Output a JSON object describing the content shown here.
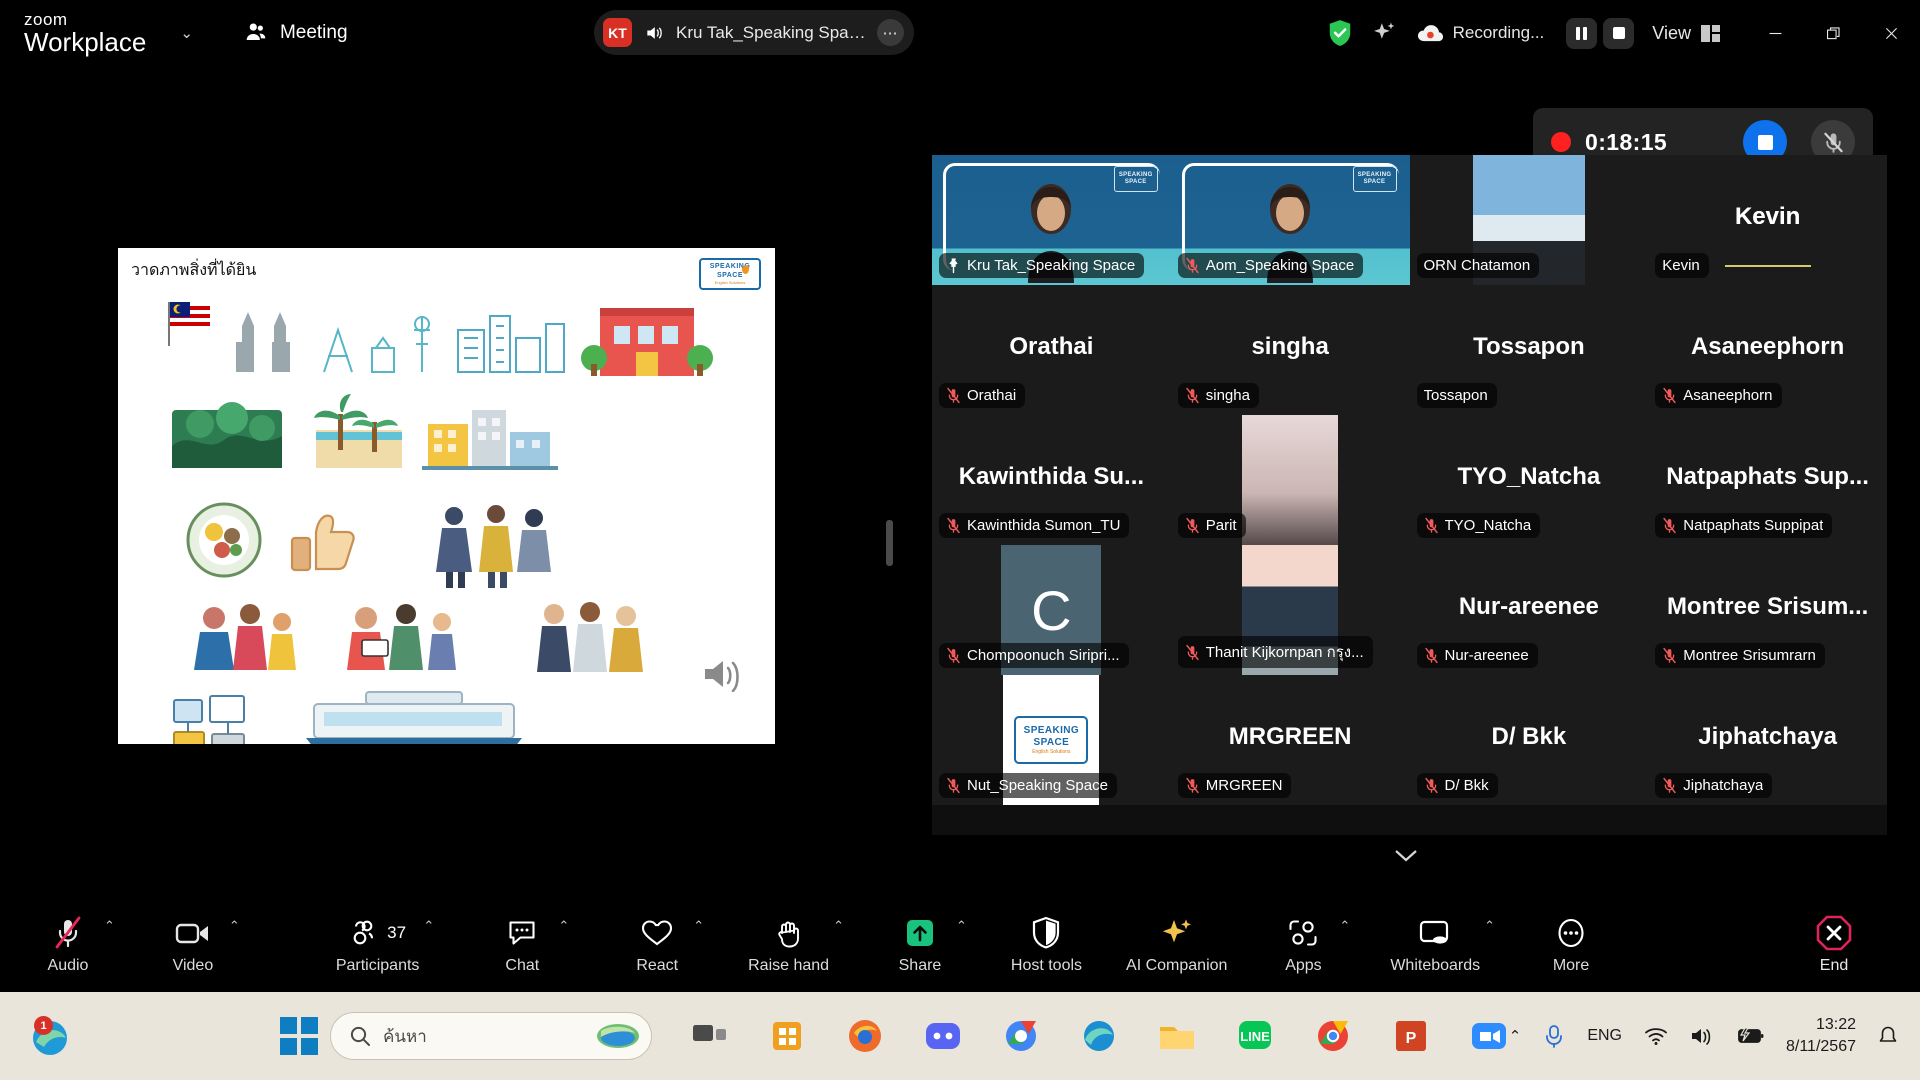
{
  "titlebar": {
    "product_line1": "zoom",
    "product_line2": "Workplace",
    "chevron": "⌄",
    "meeting_label": "Meeting",
    "meeting_pill": {
      "avatar_initials": "KT",
      "title": "Kru Tak_Speaking Space's sc",
      "more": "⋯"
    },
    "recording_label": "Recording...",
    "view_label": "View"
  },
  "recording_widget": {
    "elapsed": "0:18:15"
  },
  "share": {
    "slide_title": "วาดภาพสิ่งที่ได้ยิน",
    "logo_top": "SPEAKING",
    "logo_mid": "SPACE",
    "logo_sub": "English   Solutions",
    "side_ellipsis": "⋮"
  },
  "grid": {
    "rows": [
      [
        {
          "name": "Kru Tak_Speaking Space",
          "display": "",
          "kind": "video-blue",
          "muted": false,
          "pinned": true,
          "speaking": true
        },
        {
          "name": "Aom_Speaking Space",
          "display": "",
          "kind": "video-blue",
          "muted": true,
          "pinned": false,
          "speaking": false
        },
        {
          "name": "ORN Chatamon",
          "display": "",
          "kind": "photo-sky",
          "muted": false,
          "pinned": false,
          "speaking": false
        },
        {
          "name": "Kevin",
          "display": "Kevin",
          "kind": "name",
          "muted": false,
          "pinned": false,
          "speaking": false
        }
      ],
      [
        {
          "name": "Orathai",
          "display": "Orathai",
          "kind": "name",
          "muted": true,
          "pinned": false,
          "speaking": false
        },
        {
          "name": "singha",
          "display": "singha",
          "kind": "name",
          "muted": true,
          "pinned": false,
          "speaking": false
        },
        {
          "name": "Tossapon",
          "display": "Tossapon",
          "kind": "name",
          "muted": false,
          "pinned": false,
          "speaking": false
        },
        {
          "name": "Asaneephorn",
          "display": "Asaneephorn",
          "kind": "name",
          "muted": true,
          "pinned": false,
          "speaking": false
        }
      ],
      [
        {
          "name": "Kawinthida Sumon_TU",
          "display": "Kawinthida Su...",
          "kind": "name",
          "muted": true,
          "pinned": false,
          "speaking": false
        },
        {
          "name": "Parit",
          "display": "",
          "kind": "photo-parit",
          "muted": true,
          "pinned": false,
          "speaking": false
        },
        {
          "name": "TYO_Natcha",
          "display": "TYO_Natcha",
          "kind": "name",
          "muted": true,
          "pinned": false,
          "speaking": false
        },
        {
          "name": "Natpaphats Suppipat",
          "display": "Natpaphats Sup...",
          "kind": "name",
          "muted": true,
          "pinned": false,
          "speaking": false
        }
      ],
      [
        {
          "name": "Chompoonuch Siripri...",
          "display": "C",
          "kind": "avatar-letter",
          "muted": true,
          "pinned": false,
          "speaking": false
        },
        {
          "name": "Thanit Kijkornpan กรุง...",
          "display": "",
          "kind": "photo-thanit",
          "muted": true,
          "pinned": false,
          "speaking": false
        },
        {
          "name": "Nur-areenee",
          "display": "Nur-areenee",
          "kind": "name",
          "muted": true,
          "pinned": false,
          "speaking": false
        },
        {
          "name": "Montree Srisumrarn",
          "display": "Montree Srisum...",
          "kind": "name",
          "muted": true,
          "pinned": false,
          "speaking": false
        }
      ],
      [
        {
          "name": "Nut_Speaking Space",
          "display": "",
          "kind": "photo-logo",
          "muted": true,
          "pinned": false,
          "speaking": false
        },
        {
          "name": "MRGREEN",
          "display": "MRGREEN",
          "kind": "name",
          "muted": true,
          "pinned": false,
          "speaking": false
        },
        {
          "name": "D/ Bkk",
          "display": "D/ Bkk",
          "kind": "name",
          "muted": true,
          "pinned": false,
          "speaking": false
        },
        {
          "name": "Jiphatchaya",
          "display": "Jiphatchaya",
          "kind": "name",
          "muted": true,
          "pinned": false,
          "speaking": false
        }
      ]
    ]
  },
  "toolbar": {
    "audio": "Audio",
    "video": "Video",
    "participants": "Participants",
    "participants_count": "37",
    "chat": "Chat",
    "react": "React",
    "raise_hand": "Raise hand",
    "share": "Share",
    "host_tools": "Host tools",
    "ai_companion": "AI Companion",
    "apps": "Apps",
    "whiteboards": "Whiteboards",
    "more": "More",
    "end": "End",
    "caret": "⌃"
  },
  "taskbar": {
    "search_text": "ค้นหา",
    "edge_badge": "1",
    "tray_caret": "⌃",
    "language": "ENG",
    "time": "13:22",
    "date": "8/11/2567"
  },
  "colors": {
    "accent_blue": "#0e72ed",
    "speaking_green": "#2ee07f",
    "record_red": "#ff2020",
    "end_red": "#e02459",
    "share_green": "#19c37d",
    "ai_gold": "#f2c14e"
  }
}
